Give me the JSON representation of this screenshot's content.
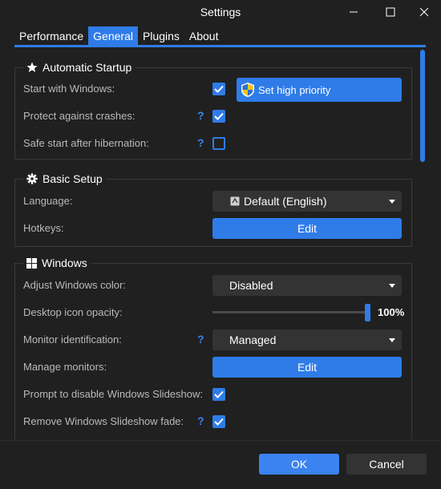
{
  "window": {
    "title": "Settings"
  },
  "tabs": [
    {
      "label": "Performance"
    },
    {
      "label": "General"
    },
    {
      "label": "Plugins"
    },
    {
      "label": "About"
    }
  ],
  "active_tab": "General",
  "startup": {
    "heading": "Automatic Startup",
    "start_with_windows": {
      "label": "Start with Windows:",
      "checked": true
    },
    "priority_button": "Set high priority",
    "protect_crashes": {
      "label": "Protect against crashes:",
      "help": "?",
      "checked": true
    },
    "safe_start": {
      "label": "Safe start after hibernation:",
      "help": "?",
      "checked": false
    }
  },
  "basic": {
    "heading": "Basic Setup",
    "language": {
      "label": "Language:",
      "value": "Default (English)"
    },
    "hotkeys": {
      "label": "Hotkeys:",
      "button": "Edit"
    }
  },
  "windows": {
    "heading": "Windows",
    "color": {
      "label": "Adjust Windows color:",
      "value": "Disabled"
    },
    "opacity": {
      "label": "Desktop icon opacity:",
      "value_text": "100%",
      "fraction": 1.0
    },
    "monitor_id": {
      "label": "Monitor identification:",
      "help": "?",
      "value": "Managed"
    },
    "manage": {
      "label": "Manage monitors:",
      "button": "Edit"
    },
    "prompt_slideshow": {
      "label": "Prompt to disable Windows Slideshow:",
      "checked": true
    },
    "remove_fade": {
      "label": "Remove Windows Slideshow fade:",
      "help": "?",
      "checked": true
    }
  },
  "footer": {
    "ok": "OK",
    "cancel": "Cancel"
  },
  "colors": {
    "accent": "#2f7ce8",
    "background": "#202020",
    "control": "#333333"
  }
}
